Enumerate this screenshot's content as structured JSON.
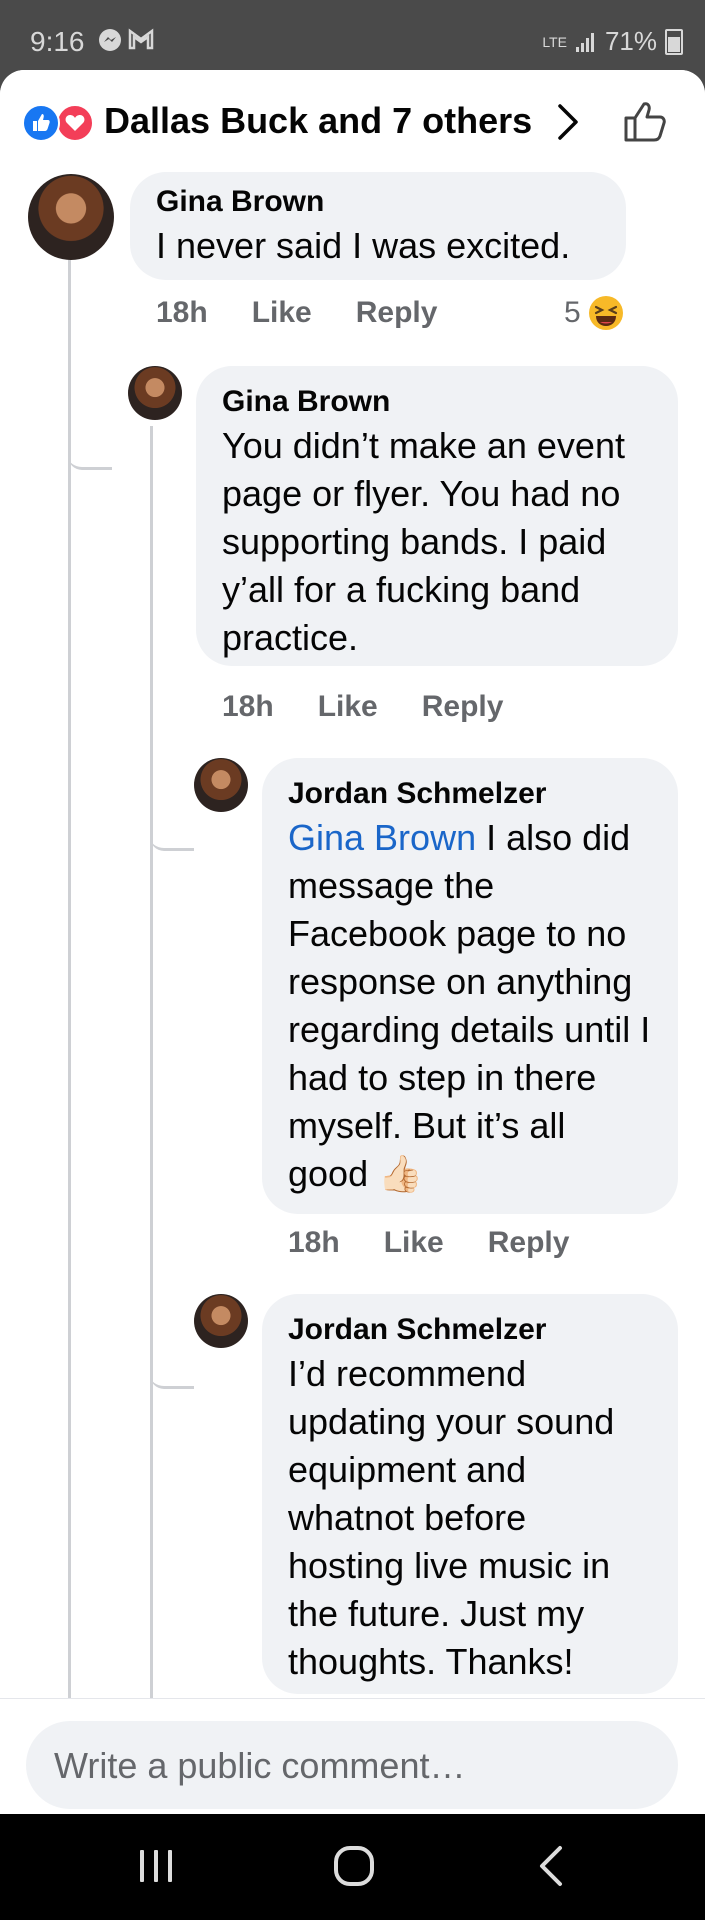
{
  "status_bar": {
    "time": "9:16",
    "signal_label": "LTE",
    "battery": "71%",
    "icons": [
      "messenger-icon",
      "gmail-icon",
      "signal-icon",
      "battery-icon"
    ]
  },
  "header": {
    "reactions": [
      "like",
      "love"
    ],
    "title": "Dallas Buck and 7 others",
    "colors": {
      "like": "#1877f2",
      "love": "#f33e58"
    }
  },
  "comments": [
    {
      "author": "Gina Brown",
      "text": "I never said I was excited.",
      "time": "18h",
      "like_label": "Like",
      "reply_label": "Reply",
      "reaction_count": "5",
      "reaction_icon": "haha-emoji-icon"
    },
    {
      "author": "Gina Brown",
      "text": "You didn’t make an event page or flyer. You had no supporting bands. I paid y’all for a fucking band practice.",
      "time": "18h",
      "like_label": "Like",
      "reply_label": "Reply"
    },
    {
      "author": "Jordan Schmelzer",
      "mention": "Gina Brown",
      "text": " I also did message the Facebook page to no response on anything regarding details until I had to step in there myself. But it’s all good ",
      "emoji": "👍🏻",
      "time": "18h",
      "like_label": "Like",
      "reply_label": "Reply"
    },
    {
      "author": "Jordan Schmelzer",
      "text": "I’d recommend updating your sound equipment and whatnot before hosting live music in the future. Just my thoughts. Thanks!"
    }
  ],
  "composer": {
    "placeholder": "Write a public comment…"
  },
  "navbar": {
    "buttons": [
      "recent-apps-icon",
      "home-icon",
      "back-icon"
    ]
  }
}
